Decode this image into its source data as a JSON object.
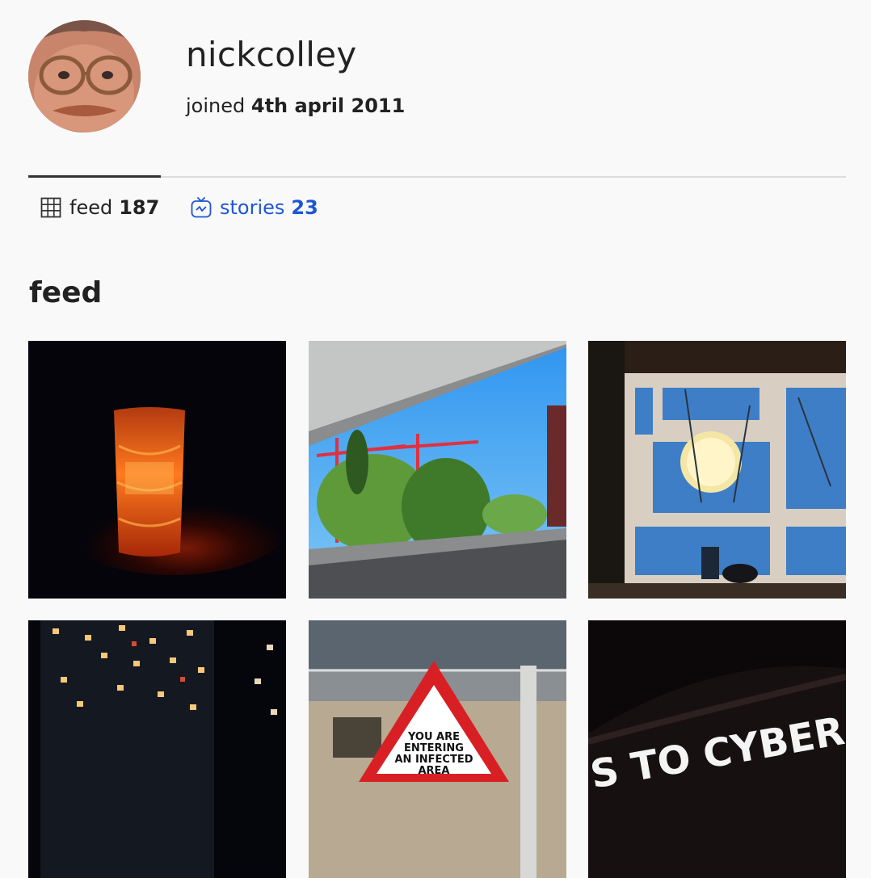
{
  "profile": {
    "username": "nickcolley",
    "joined_prefix": "joined",
    "joined_date": "4th april 2011"
  },
  "tabs": [
    {
      "label": "feed",
      "count": "187",
      "icon": "grid-icon",
      "active": true
    },
    {
      "label": "stories",
      "count": "23",
      "icon": "igtv-icon",
      "active": false
    }
  ],
  "feed": {
    "title": "feed",
    "posts": [
      {
        "subject": "glowing red glass in the dark"
      },
      {
        "subject": "red cranes and trees under blue sky through window"
      },
      {
        "subject": "window with paper lantern and bare trees at dusk"
      },
      {
        "subject": "tower block windows lit at night"
      },
      {
        "subject": "red warning triangle sign",
        "sign_text": "YOU ARE ENTERING AN INFECTED AREA"
      },
      {
        "subject": "banner text in the dark",
        "banner_text": "S TO CYBER SECURITY"
      }
    ]
  },
  "colors": {
    "background": "#f9f9f9",
    "link": "#1d56d6",
    "text": "#222222",
    "divider": "#dcdcdc"
  }
}
